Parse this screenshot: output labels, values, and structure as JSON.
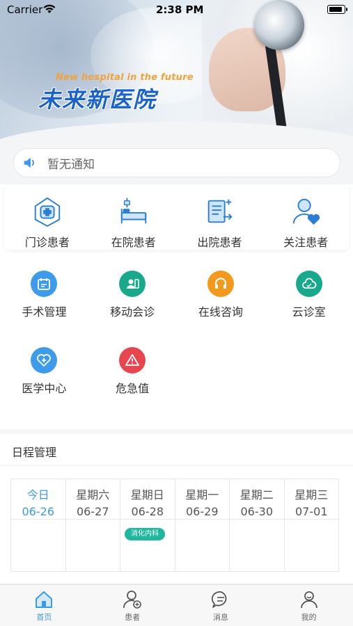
{
  "status_bar": {
    "carrier": "Carrier",
    "time": "2:38 PM",
    "battery_level": 0.9
  },
  "banner": {
    "slogan_en": "New hospital in the future",
    "slogan_cn": "未来新医院"
  },
  "notice": {
    "text": "暂无通知",
    "icon": "speaker-icon"
  },
  "patient_cards": [
    {
      "label": "门诊患者",
      "icon": "outpatient-icon"
    },
    {
      "label": "在院患者",
      "icon": "inpatient-bed-icon"
    },
    {
      "label": "出院患者",
      "icon": "discharge-icon"
    },
    {
      "label": "关注患者",
      "icon": "follow-patient-icon"
    }
  ],
  "features": [
    {
      "label": "手术管理",
      "icon": "surgery-calendar-icon",
      "color": "#3d9be9"
    },
    {
      "label": "移动会诊",
      "icon": "mobile-consult-icon",
      "color": "#18a98d"
    },
    {
      "label": "在线咨询",
      "icon": "online-consult-icon",
      "color": "#f39a1e"
    },
    {
      "label": "云诊室",
      "icon": "cloud-clinic-icon",
      "color": "#18a98d"
    },
    {
      "label": "医学中心",
      "icon": "medical-center-icon",
      "color": "#3d9be9"
    },
    {
      "label": "危急值",
      "icon": "warning-icon",
      "color": "#e8464f"
    }
  ],
  "schedule": {
    "title": "日程管理",
    "days": [
      {
        "weekday": "今日",
        "date": "06-26",
        "today": true
      },
      {
        "weekday": "星期六",
        "date": "06-27"
      },
      {
        "weekday": "星期日",
        "date": "06-28",
        "event": "消化内科"
      },
      {
        "weekday": "星期一",
        "date": "06-29"
      },
      {
        "weekday": "星期二",
        "date": "06-30"
      },
      {
        "weekday": "星期三",
        "date": "07-01"
      }
    ]
  },
  "tabbar": [
    {
      "label": "首页",
      "icon": "home-icon",
      "active": true
    },
    {
      "label": "患者",
      "icon": "patient-icon"
    },
    {
      "label": "消息",
      "icon": "message-icon"
    },
    {
      "label": "我的",
      "icon": "profile-icon"
    }
  ],
  "colors": {
    "accent": "#3b9ae8",
    "tag": "#1fb89e"
  }
}
